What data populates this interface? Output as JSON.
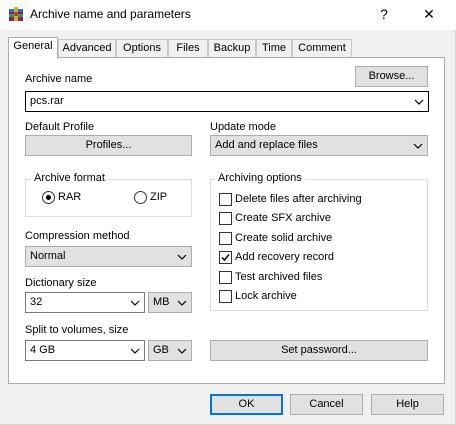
{
  "window": {
    "title": "Archive name and parameters",
    "help_glyph": "?",
    "close_glyph": "✕"
  },
  "tabs": [
    {
      "label": "General",
      "active": true
    },
    {
      "label": "Advanced"
    },
    {
      "label": "Options"
    },
    {
      "label": "Files"
    },
    {
      "label": "Backup"
    },
    {
      "label": "Time"
    },
    {
      "label": "Comment"
    }
  ],
  "archive_name": {
    "label": "Archive name",
    "value": "pcs.rar",
    "browse_label": "Browse..."
  },
  "default_profile": {
    "label": "Default Profile",
    "button_label": "Profiles..."
  },
  "update_mode": {
    "label": "Update mode",
    "value": "Add and replace files"
  },
  "archive_format": {
    "label": "Archive format",
    "options": [
      {
        "label": "RAR",
        "selected": true
      },
      {
        "label": "ZIP",
        "selected": false
      }
    ]
  },
  "compression_method": {
    "label": "Compression method",
    "value": "Normal"
  },
  "dictionary_size": {
    "label": "Dictionary size",
    "value": "32",
    "unit": "MB"
  },
  "split_volumes": {
    "label": "Split to volumes, size",
    "value": "4 GB",
    "unit": "GB"
  },
  "archiving_options": {
    "label": "Archiving options",
    "items": [
      {
        "label": "Delete files after archiving",
        "checked": false
      },
      {
        "label": "Create SFX archive",
        "checked": false
      },
      {
        "label": "Create solid archive",
        "checked": false
      },
      {
        "label": "Add recovery record",
        "checked": true
      },
      {
        "label": "Test archived files",
        "checked": false
      },
      {
        "label": "Lock archive",
        "checked": false
      }
    ]
  },
  "set_password_label": "Set password...",
  "footer": {
    "ok_label": "OK",
    "cancel_label": "Cancel",
    "help_label": "Help"
  },
  "colors": {
    "accent": "#0078d7",
    "window_bg": "#f0f0f0",
    "panel_bg": "#ffffff"
  }
}
